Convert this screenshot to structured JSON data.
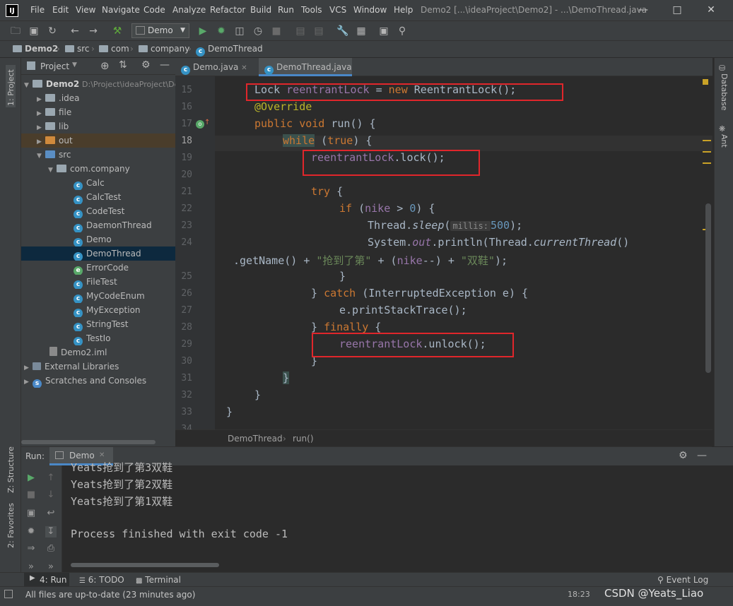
{
  "menu": [
    "File",
    "Edit",
    "View",
    "Navigate",
    "Code",
    "Analyze",
    "Refactor",
    "Build",
    "Run",
    "Tools",
    "VCS",
    "Window",
    "Help"
  ],
  "window_title": "Demo2 [...\\ideaProject\\Demo2] - ...\\DemoThread.java",
  "run_config": "Demo",
  "breadcrumb": [
    "Demo2",
    "src",
    "com",
    "company",
    "DemoThread"
  ],
  "project_header": "Project",
  "tree": [
    {
      "label": "Demo2",
      "extra": "D:\\Project\\ideaProject\\De",
      "kind": "module"
    },
    {
      "label": ".idea",
      "kind": "folder"
    },
    {
      "label": "file",
      "kind": "folder"
    },
    {
      "label": "lib",
      "kind": "folder"
    },
    {
      "label": "out",
      "kind": "folder-orange"
    },
    {
      "label": "src",
      "kind": "folder-blue"
    },
    {
      "label": "com.company",
      "kind": "package"
    },
    {
      "label": "Calc",
      "kind": "class"
    },
    {
      "label": "CalcTest",
      "kind": "class"
    },
    {
      "label": "CodeTest",
      "kind": "class"
    },
    {
      "label": "DaemonThread",
      "kind": "class"
    },
    {
      "label": "Demo",
      "kind": "class"
    },
    {
      "label": "DemoThread",
      "kind": "class"
    },
    {
      "label": "ErrorCode",
      "kind": "enum"
    },
    {
      "label": "FileTest",
      "kind": "class"
    },
    {
      "label": "MyCodeEnum",
      "kind": "class"
    },
    {
      "label": "MyException",
      "kind": "exception"
    },
    {
      "label": "StringTest",
      "kind": "class"
    },
    {
      "label": "TestIo",
      "kind": "class"
    },
    {
      "label": "Demo2.iml",
      "kind": "file"
    },
    {
      "label": "External Libraries",
      "kind": "lib"
    },
    {
      "label": "Scratches and Consoles",
      "kind": "scratch"
    }
  ],
  "tabs": [
    "Demo.java",
    "DemoThread.java"
  ],
  "line_numbers": [
    "15",
    "16",
    "17",
    "18",
    "19",
    "20",
    "21",
    "22",
    "23",
    "24",
    "",
    "25",
    "26",
    "27",
    "28",
    "29",
    "30",
    "31",
    "32",
    "33",
    "34"
  ],
  "code": {
    "l15a": "Lock ",
    "l15b": "reentrantLock",
    "l15c": " = ",
    "l15d": "new",
    "l15e": " ReentrantLock();",
    "l16": "@Override",
    "l17a": "public void",
    "l17b": " run() {",
    "l18a": "while",
    "l18b": " (",
    "l18c": "true",
    "l18d": ") {",
    "l19a": "reentrantLock",
    "l19b": ".lock();",
    "l21a": "try",
    "l21b": " {",
    "l22a": "if",
    "l22b": " (",
    "l22c": "nike",
    "l22d": " > ",
    "l22e": "0",
    "l22f": ") {",
    "l23a": "Thread.",
    "l23b": "sleep",
    "l23c": "(",
    "l23d": "millis:",
    "l23e": "500",
    "l23f": ");",
    "l24a": "System.",
    "l24b": "out",
    "l24c": ".println(Thread.",
    "l24d": "currentThread",
    "l24e": "()",
    "l24wa": ".getName() + ",
    "l24wb": "\"抢到了第\"",
    "l24wc": " + (",
    "l24wd": "nike",
    "l24we": "--) + ",
    "l24wf": "\"双鞋\"",
    "l24wg": ");",
    "l25": "}",
    "l26a": "} ",
    "l26b": "catch",
    "l26c": " (InterruptedException e) {",
    "l27": "e.printStackTrace();",
    "l28a": "} ",
    "l28b": "finally",
    "l28c": " {",
    "l29a": "reentrantLock",
    "l29b": ".unlock();",
    "l30": "}",
    "l31": "}",
    "l32": "}",
    "l33": "}"
  },
  "editor_crumbs": [
    "DemoThread",
    "run()"
  ],
  "run_panel": {
    "label": "Run:",
    "tab": "Demo",
    "output": [
      "Yeats抢到了第3双鞋",
      "Yeats抢到了第2双鞋",
      "Yeats抢到了第1双鞋",
      "",
      "Process finished with exit code -1"
    ]
  },
  "bottom_tabs": [
    "4: Run",
    "6: TODO",
    "Terminal"
  ],
  "event_log": "Event Log",
  "status": {
    "message": "All files are up-to-date (23 minutes ago)",
    "time": "18:23",
    "watermark": "CSDN @Yeats_Liao"
  },
  "side_labels": {
    "project": "1: Project",
    "structure": "Z: Structure",
    "favorites": "2: Favorites",
    "database": "Database",
    "ant": "Ant"
  }
}
